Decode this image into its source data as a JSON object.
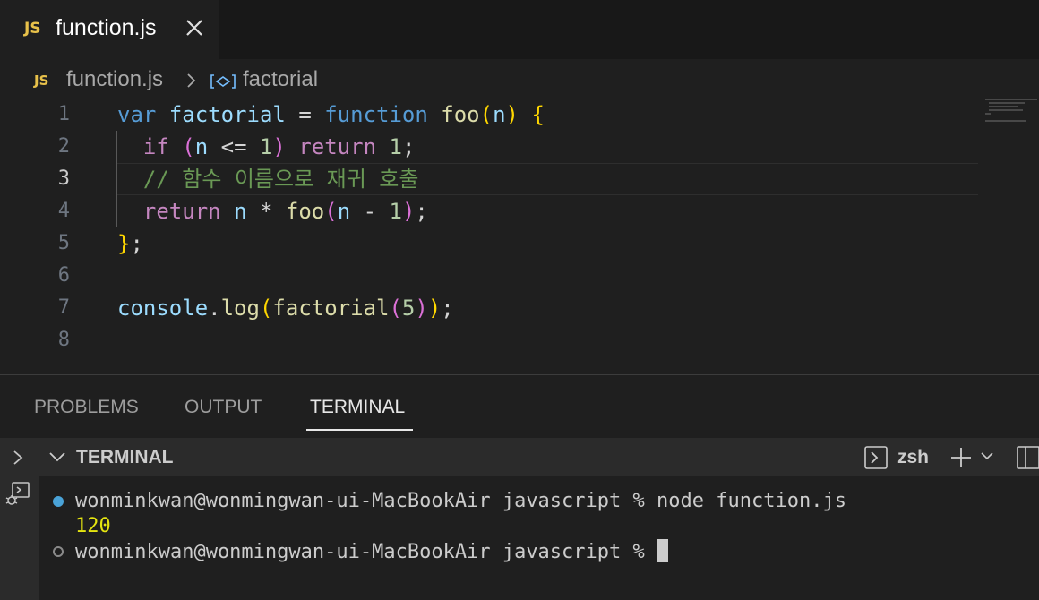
{
  "tab": {
    "badge": "JS",
    "label": "function.js",
    "close_icon": "close-icon"
  },
  "breadcrumb": {
    "badge": "JS",
    "file": "function.js",
    "symbol": "factorial",
    "symbol_icon": "symbol-variable-icon"
  },
  "editor": {
    "line_numbers": [
      "1",
      "2",
      "3",
      "4",
      "5",
      "6",
      "7",
      "8"
    ],
    "active_line": "3",
    "code": {
      "l1": {
        "a": "var",
        "b": " factorial ",
        "c": "=",
        " d": " ",
        "e": "function",
        "f": " ",
        "g": "foo",
        "h": "(",
        "i": "n",
        "j": ")",
        "k": " ",
        "l": "{"
      },
      "l2": {
        "a": "  ",
        "b": "if",
        "c": " ",
        "d": "(",
        "e": "n",
        "f": " <= ",
        "g": "1",
        "h": ")",
        "i": " ",
        "j": "return",
        "k": " ",
        "l": "1",
        "m": ";"
      },
      "l3": {
        "a": "  // 함수 이름으로 재귀 호출"
      },
      "l4": {
        "a": "  ",
        "b": "return",
        "c": " ",
        "d": "n",
        "e": " * ",
        "f": "foo",
        "g": "(",
        "h": "n",
        "i": " - ",
        "j": "1",
        "k": ")",
        "l": ";"
      },
      "l5": {
        "a": "}",
        "b": ";"
      },
      "l7": {
        "a": "console",
        "b": ".",
        "c": "log",
        "d": "(",
        "e": "factorial",
        "f": "(",
        "g": "5",
        "h": ")",
        "i": ")",
        "j": ";"
      }
    }
  },
  "panel": {
    "tabs": [
      "PROBLEMS",
      "OUTPUT",
      "TERMINAL"
    ],
    "active_tab": "TERMINAL"
  },
  "terminal": {
    "title": "TERMINAL",
    "shell": "zsh",
    "lines": [
      "wonminkwan@wonmingwan-ui-MacBookAir javascript % node function.js",
      "120",
      "wonminkwan@wonmingwan-ui-MacBookAir javascript % "
    ]
  },
  "colors": {
    "accent_js": "#e8c14a",
    "terminal_output": "#e5e510",
    "status_dot": "#4aa3d8"
  }
}
